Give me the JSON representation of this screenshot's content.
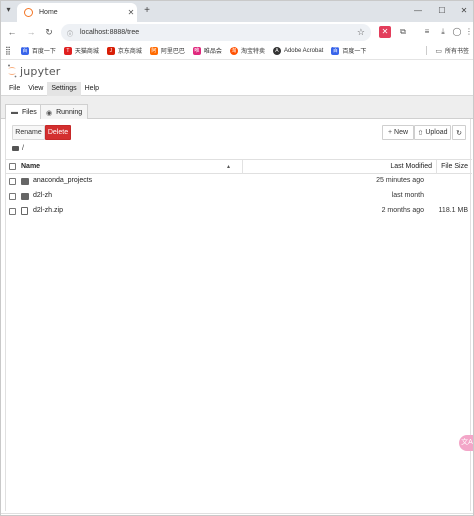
{
  "browser": {
    "tab_title": "Home",
    "new_tab": "+",
    "url": "localhost:8888/tree",
    "window_controls": {
      "minimize": "—",
      "maximize": "☐",
      "close": "✕"
    }
  },
  "bookmarks": {
    "items": [
      {
        "label": "百度一下",
        "icon_color": "#3864ea",
        "icon_glyph": "百"
      },
      {
        "label": "天猫商城",
        "icon_color": "#e02020",
        "icon_glyph": "T"
      },
      {
        "label": "京东商城",
        "icon_color": "#d81e06",
        "icon_glyph": "J"
      },
      {
        "label": "阿里巴巴",
        "icon_color": "#ff6a00",
        "icon_glyph": "阿"
      },
      {
        "label": "唯品会",
        "icon_color": "#e0287d",
        "icon_glyph": "唯"
      },
      {
        "label": "淘宝特卖",
        "icon_color": "#ff5000",
        "icon_glyph": "淘"
      },
      {
        "label": "Adobe Acrobat",
        "icon_color": "#333333",
        "icon_glyph": "A"
      },
      {
        "label": "百度一下",
        "icon_color": "#3864ea",
        "icon_glyph": "百"
      }
    ],
    "all_bookmarks": "所有书签"
  },
  "jupyter": {
    "logo_text": "jupyter",
    "menu": [
      "File",
      "View",
      "Settings",
      "Help"
    ],
    "active_menu": "Settings",
    "tabs": {
      "files": "Files",
      "running": "Running"
    },
    "toolbar": {
      "rename": "Rename",
      "delete": "Delete",
      "new": "New",
      "upload": "Upload",
      "refresh": "↻"
    },
    "breadcrumb": "/",
    "columns": {
      "name": "Name",
      "modified": "Last Modified",
      "size": "File Size"
    },
    "files": [
      {
        "name": "anaconda_projects",
        "type": "folder",
        "modified": "25 minutes ago",
        "size": ""
      },
      {
        "name": "d2l-zh",
        "type": "folder",
        "modified": "last month",
        "size": ""
      },
      {
        "name": "d2l-zh.zip",
        "type": "file",
        "modified": "2 months ago",
        "size": "118.1 MB"
      }
    ]
  },
  "colors": {
    "jupyter_orange": "#f37626",
    "delete_red": "#d32f2f"
  }
}
